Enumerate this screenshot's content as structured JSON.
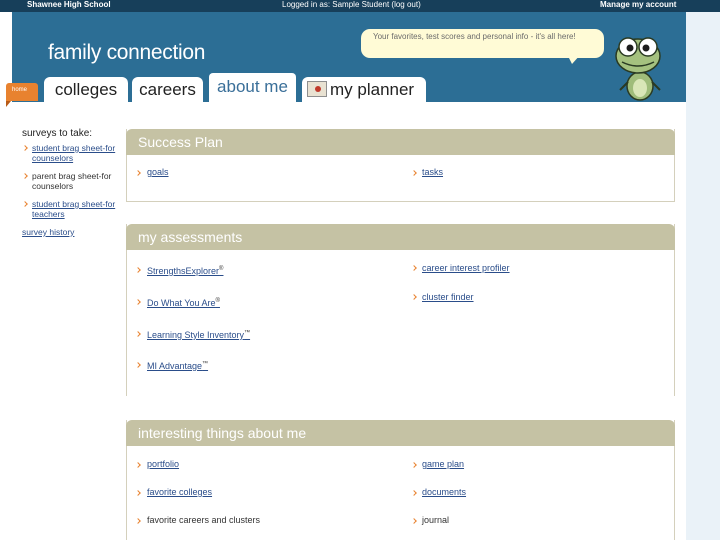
{
  "topbar": {
    "school": "Shawnee High School",
    "login": "Logged in as: Sample Student (log out)",
    "account": "Manage my account"
  },
  "header": {
    "brand": "family connection",
    "bubble_text": "Your favorites, test scores and personal info - it's all here!",
    "home_label": "home"
  },
  "tabs": [
    {
      "label": "colleges"
    },
    {
      "label": "careers"
    },
    {
      "label": "about me",
      "active": true
    },
    {
      "label": "my planner"
    }
  ],
  "surveys": {
    "title": "surveys to take:",
    "items": [
      {
        "line1": "student brag sheet-for",
        "line2": "counselors",
        "is_link": true
      },
      {
        "line1": "parent brag sheet-for",
        "line2": "counselors",
        "is_link": false
      },
      {
        "line1": "student brag sheet-for",
        "line2": "teachers",
        "is_link": true
      }
    ],
    "history": "survey history"
  },
  "success_plan": {
    "title": "Success Plan",
    "left": "goals",
    "right": "tasks"
  },
  "assessments": {
    "title": "my assessments",
    "left": [
      {
        "label": "StrengthsExplorer",
        "mark": "®"
      },
      {
        "label": "Do What You Are",
        "mark": "®"
      },
      {
        "label": "Learning Style Inventory",
        "mark": "™"
      },
      {
        "label": "MI Advantage",
        "mark": "™"
      }
    ],
    "right": [
      {
        "label": "career interest profiler"
      },
      {
        "label": "cluster finder"
      }
    ]
  },
  "interesting": {
    "title": "interesting things about me",
    "left": [
      "portfolio",
      "favorite colleges",
      "favorite careers and clusters"
    ],
    "right": [
      "game plan",
      "documents",
      "journal"
    ]
  },
  "colors": {
    "header_blue": "#2c6e95",
    "topbar_navy": "#173f5a",
    "panel_header": "#c5c2a4",
    "accent_orange": "#e8822f",
    "link_blue": "#2a4d8a"
  }
}
